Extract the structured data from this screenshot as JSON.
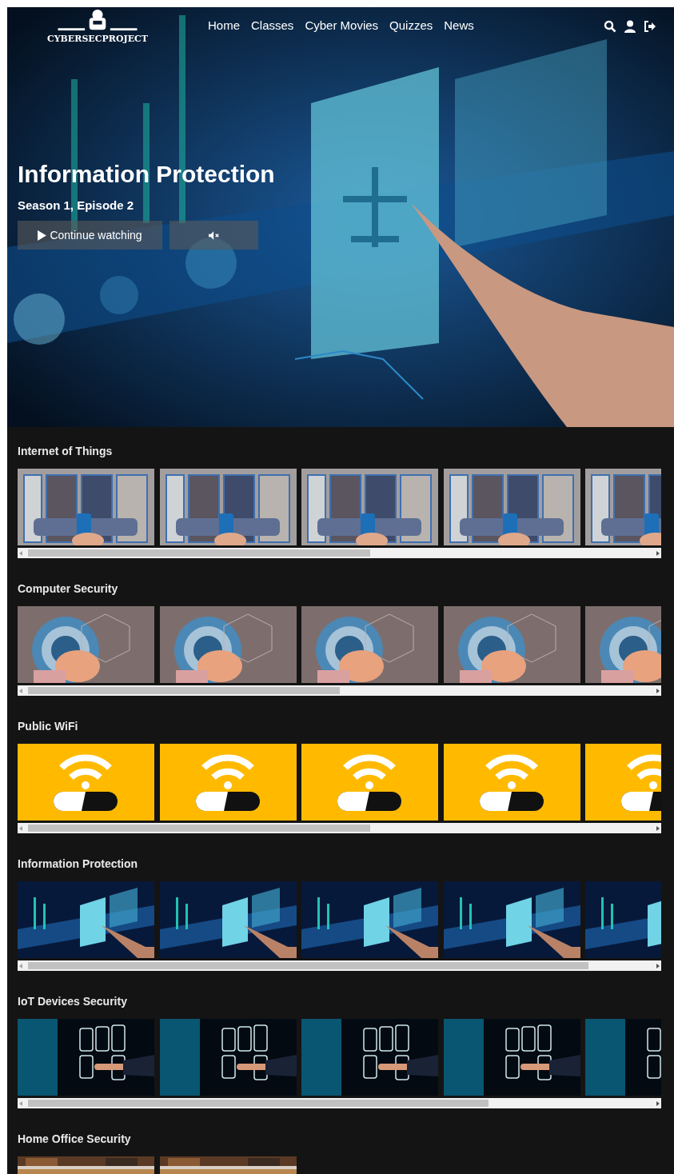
{
  "header": {
    "logo": "CYBERSECPROJECT",
    "nav": [
      "Home",
      "Classes",
      "Cyber Movies",
      "Quizzes",
      "News"
    ]
  },
  "hero": {
    "kind": "picture",
    "title": "Information Protection",
    "subtitle": "Season 1, Episode 2",
    "play_button": "Continue watching"
  },
  "rows": [
    {
      "title": "Internet of Things"
    },
    {
      "title": "Computer Security"
    },
    {
      "title": "Public WiFi"
    },
    {
      "title": "Information Protection"
    },
    {
      "title": "IoT Devices Security"
    },
    {
      "title": "Home Office Security"
    }
  ]
}
